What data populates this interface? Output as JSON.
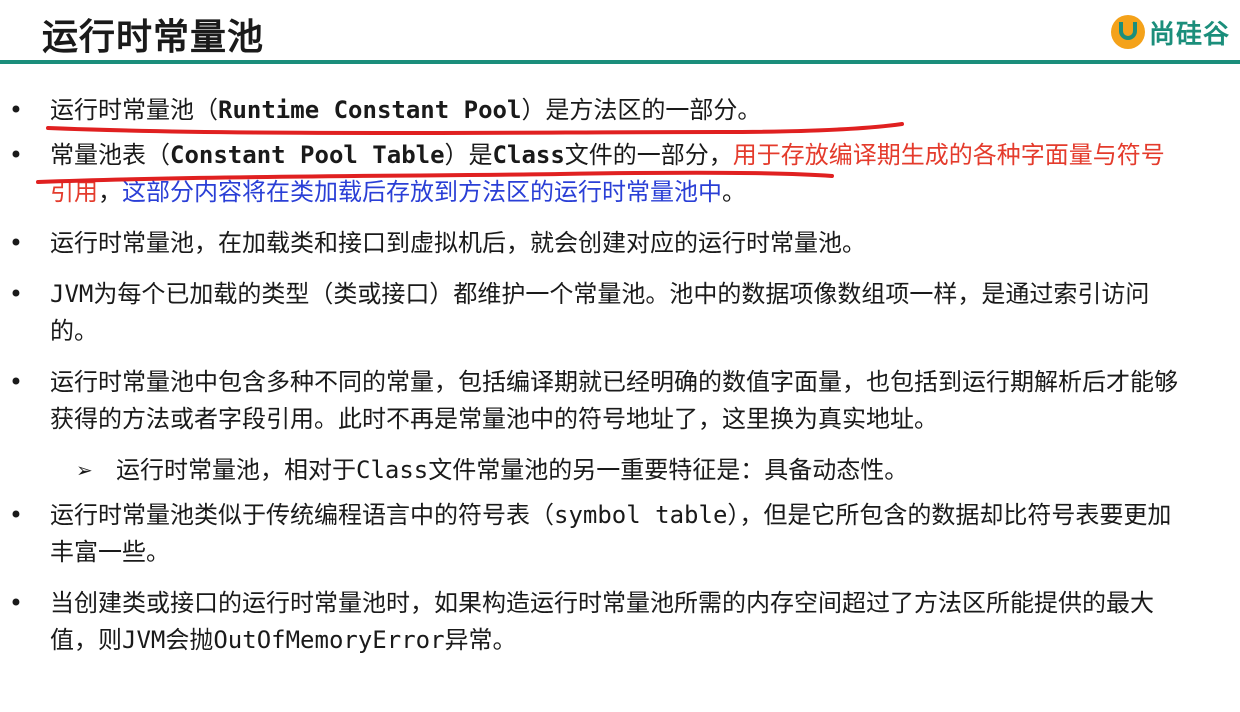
{
  "header": {
    "title": "运行时常量池",
    "logo_text": "尚硅谷",
    "logo_icon": "u-logo-icon",
    "accent_color": "#1b8e7b"
  },
  "bullets": [
    {
      "pre": "运行时常量池（",
      "code": "Runtime Constant Pool",
      "post": "）是方法区的一部分。"
    },
    {
      "pre": "常量池表（",
      "code": "Constant Pool Table",
      "mid": "）是",
      "code2": "Class",
      "post": "文件的一部分，",
      "red": "用于存放编译期生成的各种字面量与符号引用",
      "comma": "，",
      "blue": "这部分内容将在类加载后存放到方法区的运行时常量池中",
      "end": "。"
    },
    {
      "text": "运行时常量池，在加载类和接口到虚拟机后，就会创建对应的运行时常量池。"
    },
    {
      "code": "JVM",
      "text": "为每个已加载的类型（类或接口）都维护一个常量池。池中的数据项像数组项一样，是通过索引访问的。"
    },
    {
      "text": "运行时常量池中包含多种不同的常量，包括编译期就已经明确的数值字面量，也包括到运行期解析后才能够获得的方法或者字段引用。此时不再是常量池中的符号地址了，这里换为真实地址。"
    }
  ],
  "sub_bullet": {
    "pre": "运行时常量池，相对于",
    "code": "Class",
    "post": "文件常量池的另一重要特征是：具备动态性。"
  },
  "bullets2": [
    {
      "pre": "运行时常量池类似于传统编程语言中的符号表（",
      "code": "symbol table",
      "post": "），但是它所包含的数据却比符号表要更加丰富一些。"
    },
    {
      "pre": "当创建类或接口的运行时常量池时，如果构造运行时常量池所需的内存空间超过了方法区所能提供的最大值，则",
      "code": "JVM",
      "mid": "会抛",
      "code2": "OutOfMemoryError",
      "post": "异常。"
    }
  ],
  "colors": {
    "red": "#e43b2c",
    "blue": "#2a3fd6",
    "annotation": "#e02020"
  }
}
